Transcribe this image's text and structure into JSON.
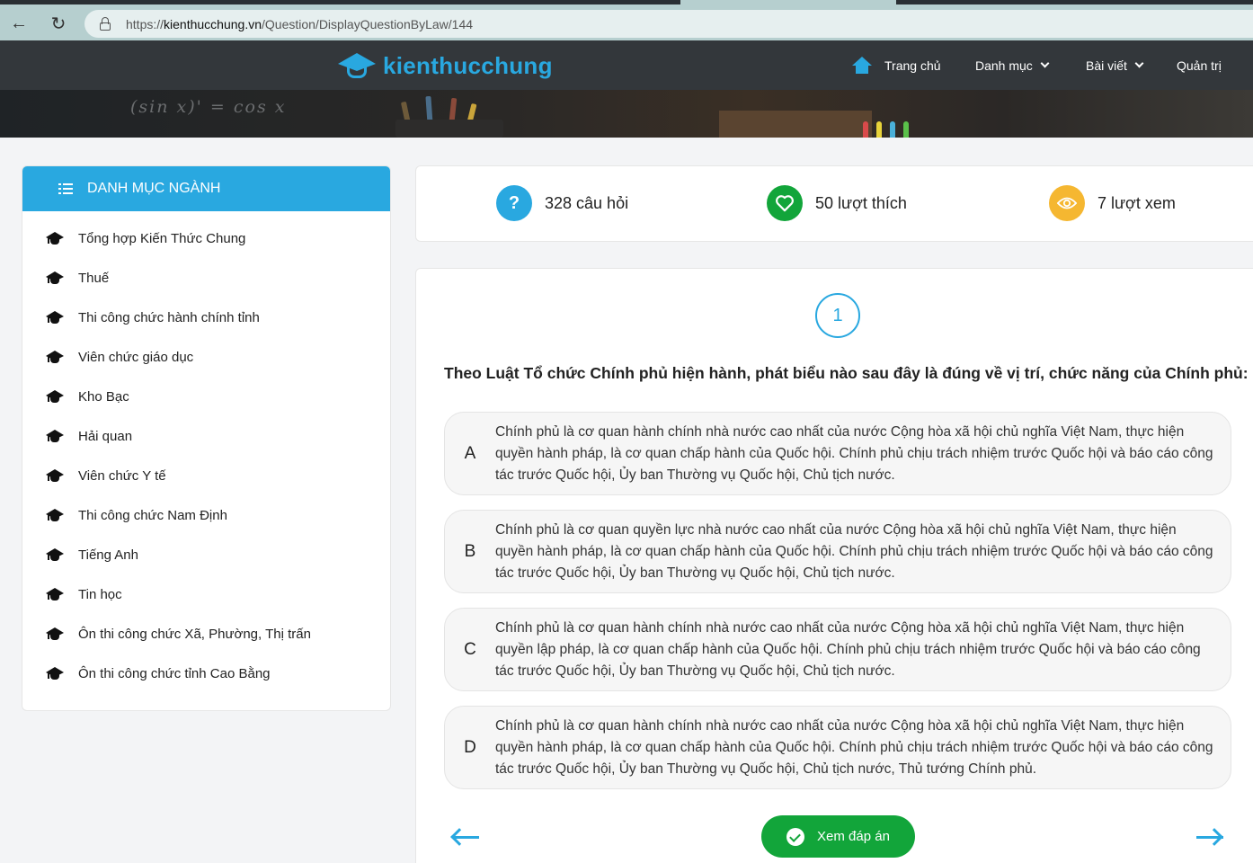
{
  "browser": {
    "url_prefix": "https://",
    "url_host": "kienthucchung.vn",
    "url_path": "/Question/DisplayQuestionByLaw/144"
  },
  "header": {
    "logo_text": "kienthucchung",
    "hero_text": "(sin x)' = cos x",
    "menu": {
      "home": "Trang chủ",
      "danhmuc": "Danh mục",
      "baiviet": "Bài viết",
      "quantri": "Quản trị"
    }
  },
  "sidebar": {
    "title": "DANH MỤC NGÀNH",
    "items": [
      {
        "label": "Tổng hợp Kiến Thức Chung"
      },
      {
        "label": "Thuế"
      },
      {
        "label": "Thi công chức hành chính tỉnh"
      },
      {
        "label": "Viên chức giáo dục"
      },
      {
        "label": "Kho Bạc"
      },
      {
        "label": "Hải quan"
      },
      {
        "label": "Viên chức Y tế"
      },
      {
        "label": "Thi công chức Nam Định"
      },
      {
        "label": "Tiếng Anh"
      },
      {
        "label": "Tin học"
      },
      {
        "label": "Ôn thi công chức Xã, Phường, Thị trấn"
      },
      {
        "label": "Ôn thi công chức tỉnh Cao Bằng"
      }
    ]
  },
  "stats": {
    "questions": "328 câu hỏi",
    "likes": "50 lượt thích",
    "views": "7 lượt xem"
  },
  "question": {
    "number": "1",
    "text": "Theo Luật Tổ chức Chính phủ hiện hành, phát biểu nào sau đây là đúng về vị trí, chức năng của Chính phủ:",
    "options": [
      {
        "letter": "A",
        "text": "Chính phủ là cơ quan hành chính nhà nước cao nhất của nước Cộng hòa xã hội chủ nghĩa Việt Nam, thực hiện quyền hành pháp, là cơ quan chấp hành của Quốc hội. Chính phủ chịu trách nhiệm trước Quốc hội và báo cáo công tác trước Quốc hội, Ủy ban Thường vụ Quốc hội, Chủ tịch nước."
      },
      {
        "letter": "B",
        "text": "Chính phủ là cơ quan quyền lực nhà nước cao nhất của nước Cộng hòa xã hội chủ nghĩa Việt Nam, thực hiện quyền hành pháp, là cơ quan chấp hành của Quốc hội. Chính phủ chịu trách nhiệm trước Quốc hội và báo cáo công tác trước Quốc hội, Ủy ban Thường vụ Quốc hội, Chủ tịch nước."
      },
      {
        "letter": "C",
        "text": "Chính phủ là cơ quan hành chính nhà nước cao nhất của nước Cộng hòa xã hội chủ nghĩa Việt Nam, thực hiện quyền lập pháp, là cơ quan chấp hành của Quốc hội. Chính phủ chịu trách nhiệm trước Quốc hội và báo cáo công tác trước Quốc hội, Ủy ban Thường vụ Quốc hội, Chủ tịch nước."
      },
      {
        "letter": "D",
        "text": "Chính phủ là cơ quan hành chính nhà nước cao nhất của nước Cộng hòa xã hội chủ nghĩa Việt Nam, thực hiện quyền hành pháp, là cơ quan chấp hành của Quốc hội. Chính phủ chịu trách nhiệm trước Quốc hội và báo cáo công tác trước Quốc hội, Ủy ban Thường vụ Quốc hội, Chủ tịch nước, Thủ tướng Chính phủ."
      }
    ],
    "answer_button": "Xem đáp án"
  },
  "icons": {
    "back": "arrow-left-icon",
    "reload": "reload-icon",
    "lock": "lock-icon",
    "logo": "graduation-cap-icon",
    "home": "home-icon",
    "list": "list-icon",
    "sidebar_item": "graduation-cap-icon",
    "questions": "question-icon",
    "likes": "heart-icon",
    "views": "eye-icon",
    "answer": "check-circle-icon"
  },
  "colors": {
    "brand": "#29a8e0",
    "success": "#12a53a",
    "warning": "#f5b731",
    "header_bg": "#33373b"
  }
}
